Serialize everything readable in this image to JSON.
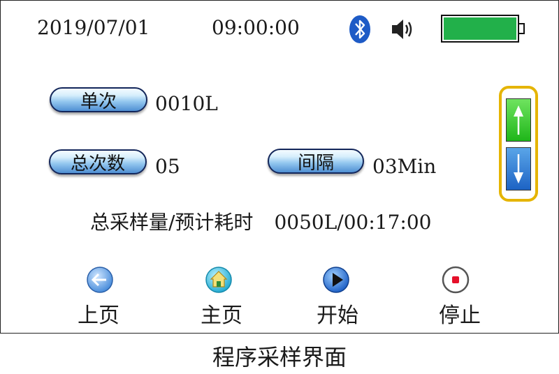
{
  "status": {
    "date": "2019/07/01",
    "time": "09:00:00",
    "battery_level_pct": 100,
    "battery_color": "#22b04a",
    "icons": [
      "bluetooth-icon",
      "speaker-icon",
      "battery-icon"
    ]
  },
  "fields": {
    "single_label": "单次",
    "single_value": "0010L",
    "total_label": "总次数",
    "total_value": "05",
    "interval_label": "间隔",
    "interval_value": "03Min"
  },
  "summary": {
    "label": "总采样量/预计耗时",
    "value": "0050L/00:17:00"
  },
  "scroll": {
    "up_icon": "arrow-up-icon",
    "down_icon": "arrow-down-icon"
  },
  "nav": [
    {
      "label": "上页",
      "icon": "back-arrow-icon"
    },
    {
      "label": "主页",
      "icon": "home-icon"
    },
    {
      "label": "开始",
      "icon": "play-icon"
    },
    {
      "label": "停止",
      "icon": "stop-icon"
    }
  ],
  "caption": "程序采样界面"
}
